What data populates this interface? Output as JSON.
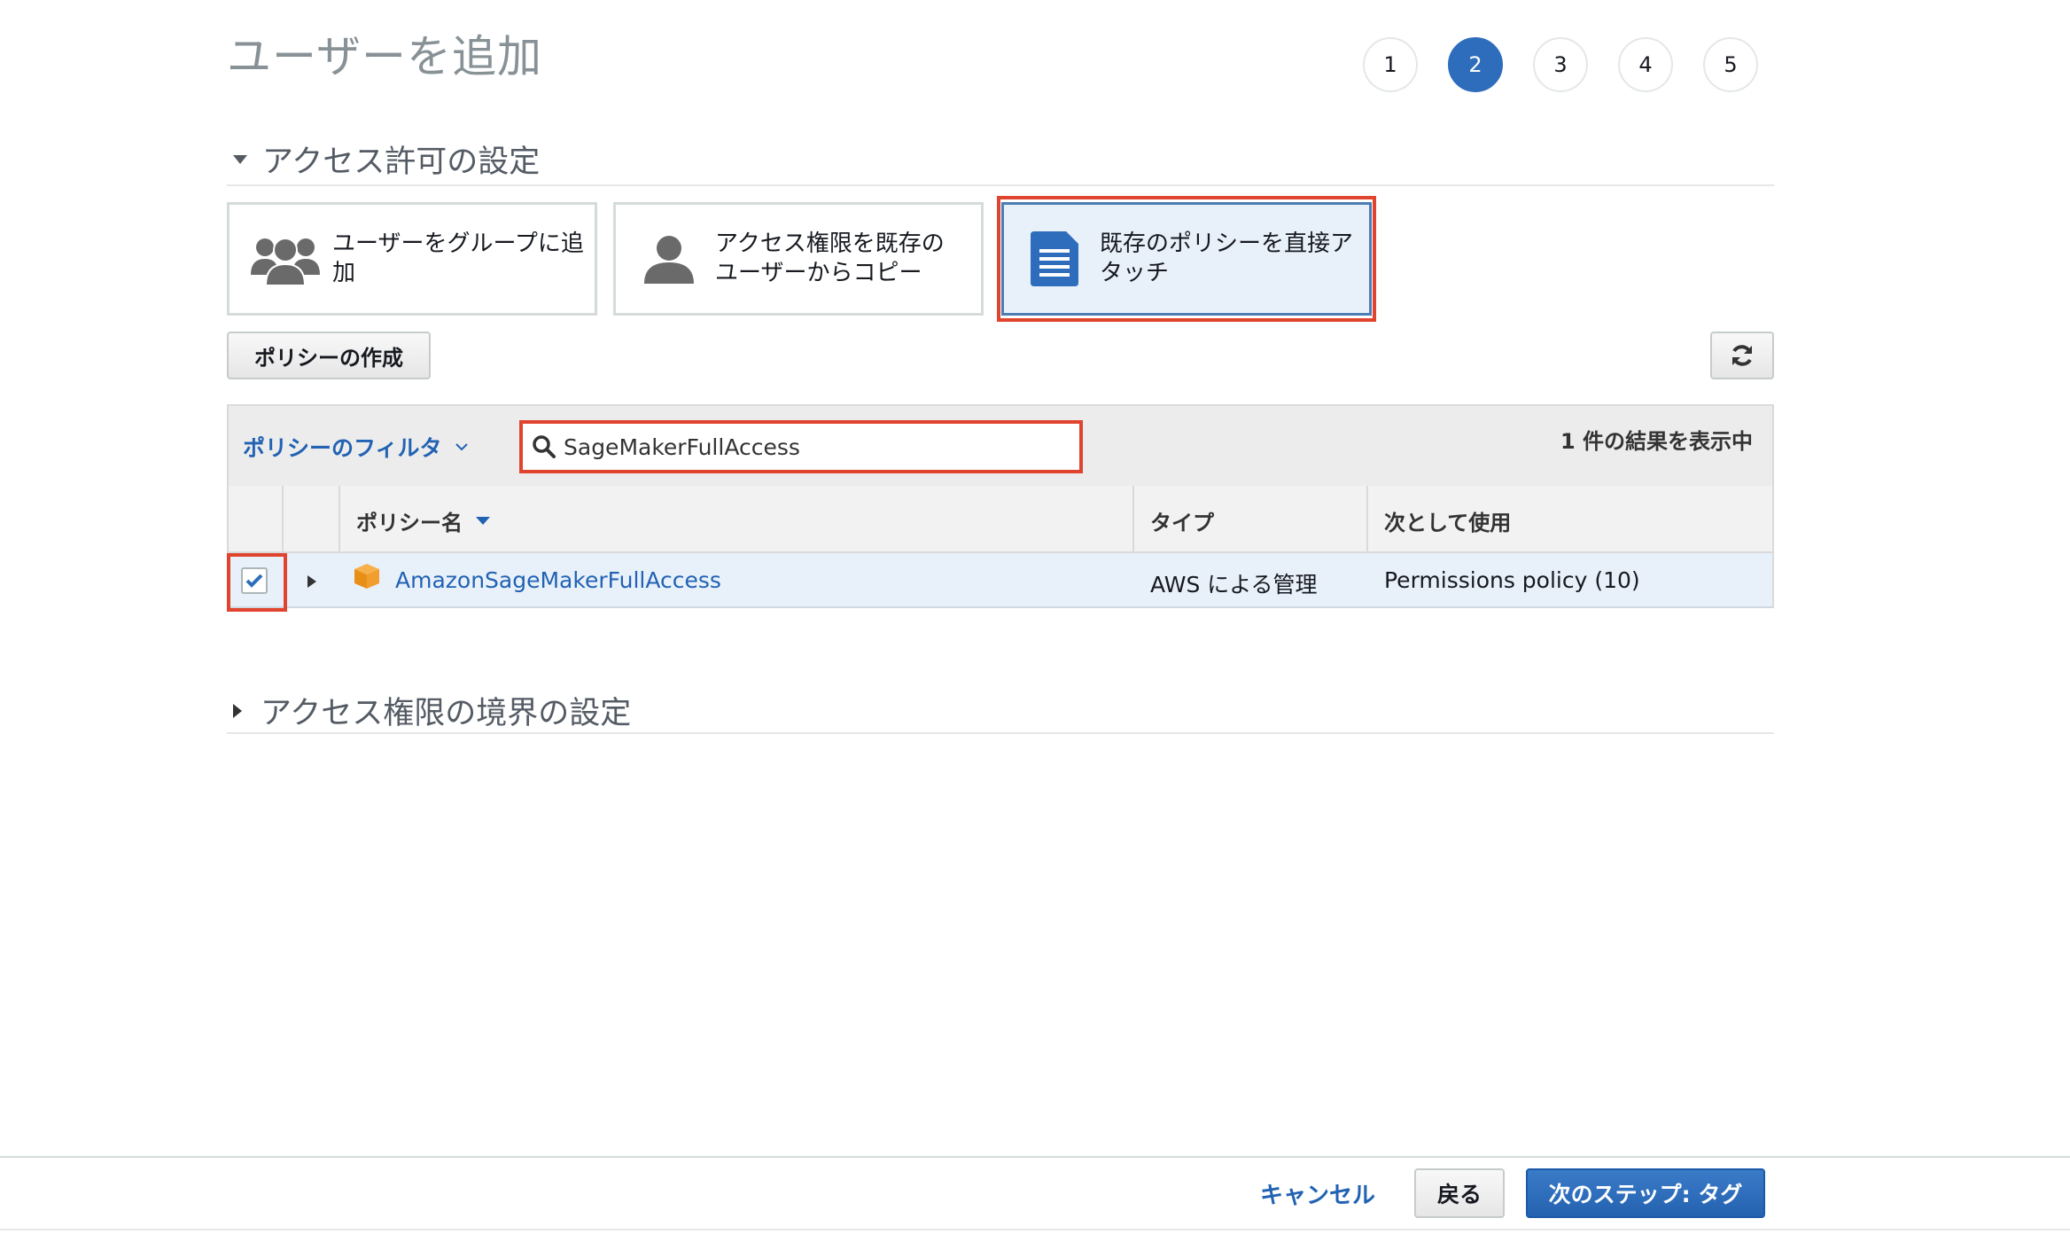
{
  "page": {
    "title": "ユーザーを追加"
  },
  "steps": [
    "1",
    "2",
    "3",
    "4",
    "5"
  ],
  "active_step": "2",
  "permissions_section": {
    "title": "アクセス許可の設定",
    "options": [
      {
        "label_line1": "ユーザーをグループに追",
        "label_line2": "加",
        "icon": "user-group-icon"
      },
      {
        "label_line1": "アクセス権限を既存の",
        "label_line2": "ユーザーからコピー",
        "icon": "user-icon"
      },
      {
        "label_line1": "既存のポリシーを直接ア",
        "label_line2": "タッチ",
        "icon": "document-icon",
        "selected": true
      }
    ],
    "create_policy_button": "ポリシーの作成",
    "refresh_icon": "refresh-icon"
  },
  "policy_table": {
    "filter_label": "ポリシーのフィルタ",
    "search_value": "SageMakerFullAccess",
    "result_count": "1 件の結果を表示中",
    "columns": {
      "name": "ポリシー名",
      "type": "タイプ",
      "used_as": "次として使用"
    },
    "rows": [
      {
        "checked": true,
        "name": "AmazonSageMakerFullAccess",
        "type": "AWS による管理",
        "used_as": "Permissions policy (10)"
      }
    ]
  },
  "boundary_section": {
    "title": "アクセス権限の境界の設定"
  },
  "footer": {
    "cancel": "キャンセル",
    "back": "戻る",
    "next": "次のステップ: タグ"
  },
  "colors": {
    "accent": "#2e6dbc",
    "link": "#2262b3",
    "highlight_red": "#e0442e",
    "selected_row": "#e8f1fa"
  }
}
